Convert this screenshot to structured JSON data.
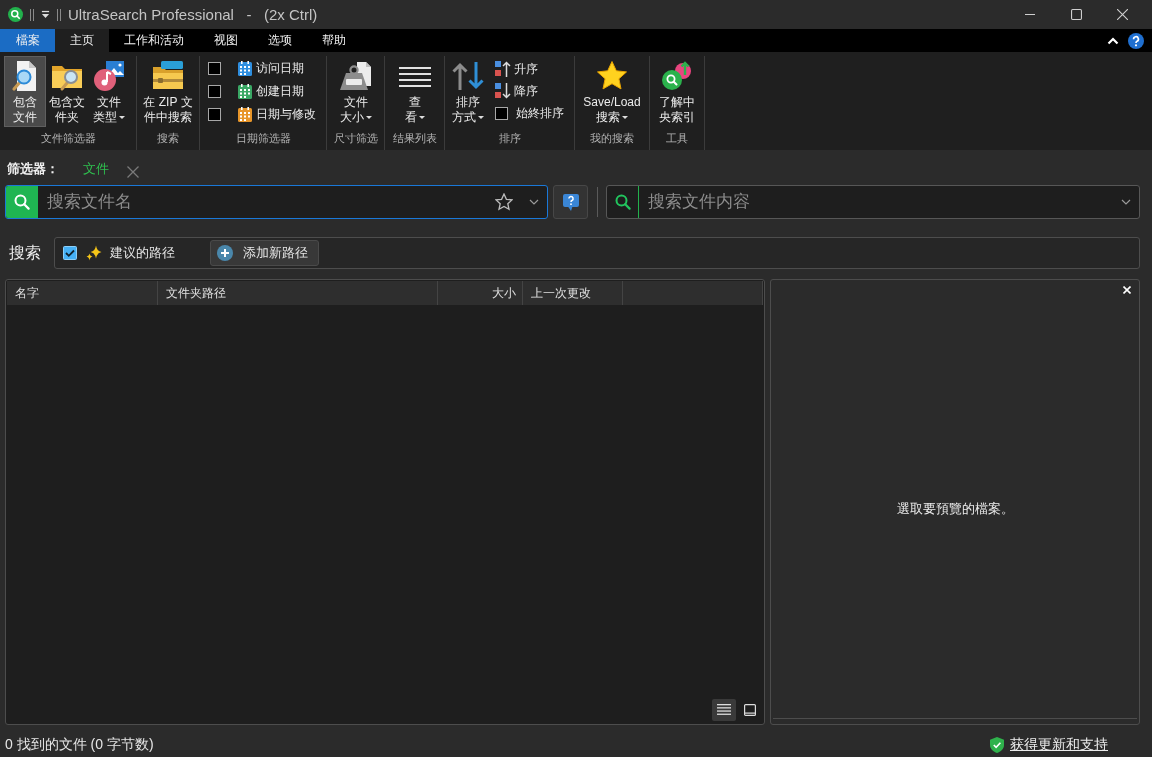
{
  "window": {
    "title": "UltraSearch Professional   -   (2x Ctrl)"
  },
  "menu_tabs": [
    {
      "label": "檔案",
      "kind": "backstage",
      "selected": false
    },
    {
      "label": "主页",
      "kind": "tab",
      "selected": true
    },
    {
      "label": "工作和活动",
      "kind": "tab",
      "selected": false
    },
    {
      "label": "视图",
      "kind": "tab",
      "selected": false
    },
    {
      "label": "选项",
      "kind": "tab",
      "selected": false
    },
    {
      "label": "帮助",
      "kind": "tab",
      "selected": false
    }
  ],
  "ribbon": {
    "file_filter": {
      "label": "文件筛选器",
      "buttons": [
        {
          "lines": [
            "包含",
            "文件"
          ],
          "on": true
        },
        {
          "lines": [
            "包含文",
            "件夹"
          ],
          "on": false
        },
        {
          "lines": [
            "文件",
            "类型"
          ],
          "dropdown": true
        }
      ]
    },
    "search": {
      "label": "搜索",
      "buttons": [
        {
          "lines": [
            "在 ZIP 文",
            "件中搜索"
          ]
        }
      ]
    },
    "date_filter": {
      "label": "日期筛选器",
      "options": [
        {
          "label": "访问日期",
          "checked": false,
          "color": "#2f8fe0"
        },
        {
          "label": "创建日期",
          "checked": false,
          "color": "#3aa865"
        },
        {
          "label": "日期与修改",
          "checked": false,
          "color": "#e8962a"
        }
      ]
    },
    "size_filter": {
      "label": "尺寸筛选",
      "buttons": [
        {
          "lines": [
            "文件",
            "大小"
          ],
          "dropdown": true
        }
      ]
    },
    "result_list": {
      "label": "结果列表",
      "buttons": [
        {
          "lines": [
            "查",
            "看"
          ],
          "dropdown": true
        }
      ]
    },
    "sort": {
      "label": "排序",
      "buttons": [
        {
          "lines": [
            "排序",
            "方式"
          ],
          "dropdown": true
        }
      ],
      "orders": [
        {
          "label": "升序"
        },
        {
          "label": "降序"
        }
      ],
      "always_sort": {
        "label": "始終排序",
        "checked": false
      }
    },
    "my_searches": {
      "label": "我的搜索",
      "buttons": [
        {
          "lines": [
            "Save/Load",
            "搜索"
          ],
          "dropdown": true
        }
      ]
    },
    "tools": {
      "label": "工具",
      "buttons": [
        {
          "lines": [
            "了解中",
            "央索引"
          ]
        }
      ]
    }
  },
  "filter_bar": {
    "label": "筛选器：",
    "tabs": [
      {
        "label": "文件",
        "selected": true
      }
    ]
  },
  "name_search": {
    "placeholder": "搜索文件名"
  },
  "content_search": {
    "placeholder": "搜索文件内容"
  },
  "paths": {
    "label": "搜索",
    "suggested": {
      "label": "建议的路径",
      "checked": true
    },
    "add_button": "添加新路径"
  },
  "results": {
    "columns": [
      {
        "label": "名字",
        "kind": "text"
      },
      {
        "label": "文件夹路径",
        "kind": "text"
      },
      {
        "label": "大小",
        "kind": "number"
      },
      {
        "label": "上一次更改",
        "kind": "text"
      }
    ],
    "view_modes": [
      {
        "selected": true
      },
      {
        "selected": false
      }
    ]
  },
  "preview": {
    "message": "選取要預覽的檔案。"
  },
  "status_bar": {
    "summary": "0 找到的文件 (0 字节数)",
    "link": "获得更新和支持"
  }
}
